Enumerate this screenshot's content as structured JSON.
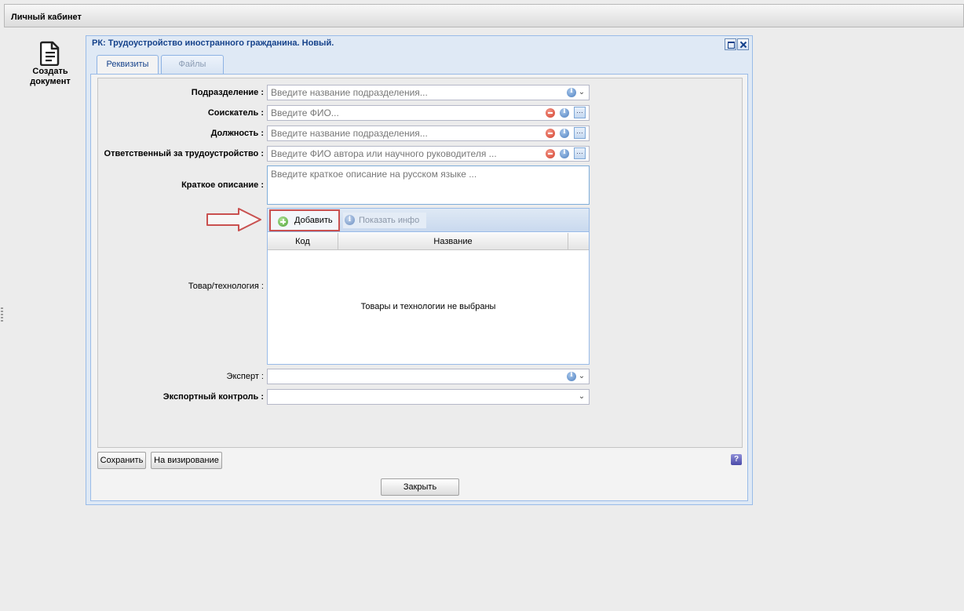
{
  "app": {
    "title": "Личный кабинет"
  },
  "create_doc": {
    "label_line1": "Создать",
    "label_line2": "документ"
  },
  "window": {
    "title": "РК: Трудоустройство иностранного гражданина. Новый.",
    "tabs": [
      {
        "label": "Реквизиты",
        "active": true
      },
      {
        "label": "Файлы",
        "active": false
      }
    ]
  },
  "form": {
    "department": {
      "label": "Подразделение :",
      "placeholder": "Введите название подразделения..."
    },
    "applicant": {
      "label": "Соискатель :",
      "placeholder": "Введите ФИО..."
    },
    "position": {
      "label": "Должность :",
      "placeholder": "Введите название подразделения..."
    },
    "responsible": {
      "label": "Ответственный за трудоустройство :",
      "placeholder": "Введите ФИО автора или научного руководителя ..."
    },
    "summary": {
      "label": "Краткое описание :",
      "placeholder": "Введите краткое описание на русском языке ..."
    },
    "goods": {
      "label": "Товар/технология :",
      "add_label": "Добавить",
      "info_label": "Показать инфо",
      "columns": [
        "Код",
        "Название"
      ],
      "empty_text": "Товары и технологии не выбраны"
    },
    "expert": {
      "label": "Эксперт :",
      "value": ""
    },
    "export_control": {
      "label": "Экспортный контроль :",
      "value": ""
    }
  },
  "buttons": {
    "save": "Сохранить",
    "to_approval": "На визирование",
    "close": "Закрыть",
    "help": "?"
  },
  "colors": {
    "highlight": "#c9504f",
    "accent": "#15428b"
  }
}
